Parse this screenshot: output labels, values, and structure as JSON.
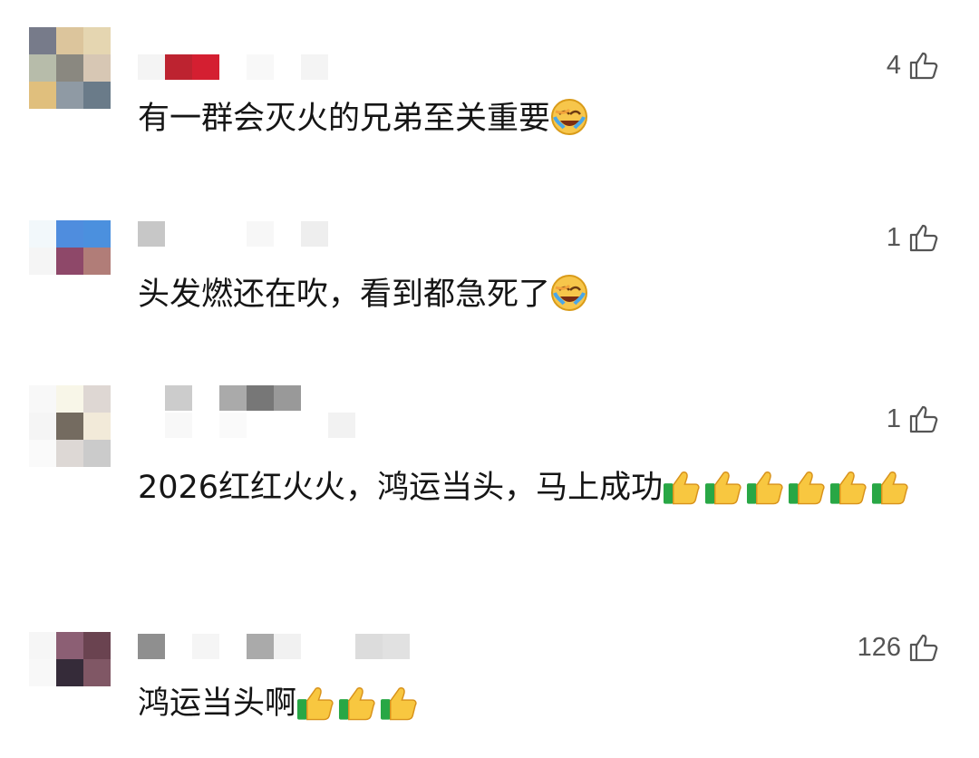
{
  "comments": [
    {
      "likes": "4",
      "text": "有一群会灭火的兄弟至关重要",
      "emoji": "laugh-cry-icon"
    },
    {
      "likes": "1",
      "text": "头发燃还在吹，看到都急死了",
      "emoji": "laugh-cry-icon"
    },
    {
      "likes": "1",
      "text": "2026红红火火，鸿运当头，马上成功",
      "emoji": "thumbs-up-icon"
    },
    {
      "likes": "126",
      "text": "鸿运当头啊",
      "emoji": "thumbs-up-icon"
    }
  ],
  "colors": {
    "like_text": "#555555",
    "comment_text": "#151515"
  }
}
